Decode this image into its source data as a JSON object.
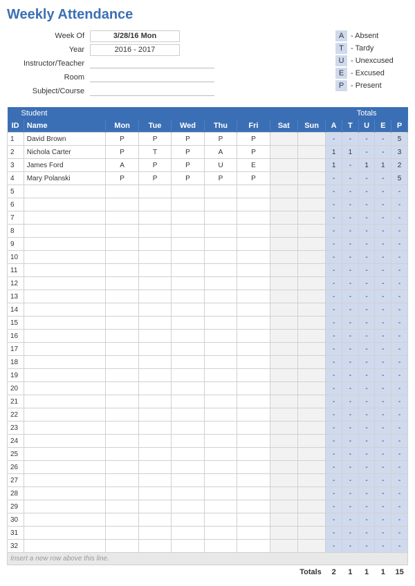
{
  "title": "Weekly Attendance",
  "info": {
    "weekOfLabel": "Week Of",
    "weekOfValue": "3/28/16 Mon",
    "yearLabel": "Year",
    "yearValue": "2016 - 2017",
    "instructorLabel": "Instructor/Teacher",
    "roomLabel": "Room",
    "subjectLabel": "Subject/Course"
  },
  "legend": [
    {
      "code": "A",
      "text": "- Absent"
    },
    {
      "code": "T",
      "text": "- Tardy"
    },
    {
      "code": "U",
      "text": "- Unexcused"
    },
    {
      "code": "E",
      "text": "- Excused"
    },
    {
      "code": "P",
      "text": "- Present"
    }
  ],
  "headers": {
    "student": "Student",
    "totals": "Totals",
    "id": "ID",
    "name": "Name",
    "days": [
      "Mon",
      "Tue",
      "Wed",
      "Thu",
      "Fri",
      "Sat",
      "Sun"
    ],
    "totCols": [
      "A",
      "T",
      "U",
      "E",
      "P"
    ]
  },
  "rows": [
    {
      "id": "1",
      "name": "David Brown",
      "d": [
        "P",
        "P",
        "P",
        "P",
        "P",
        "",
        ""
      ],
      "t": [
        "-",
        "-",
        "-",
        "-",
        "5"
      ]
    },
    {
      "id": "2",
      "name": "Nichola Carter",
      "d": [
        "P",
        "T",
        "P",
        "A",
        "P",
        "",
        ""
      ],
      "t": [
        "1",
        "1",
        "-",
        "-",
        "3"
      ]
    },
    {
      "id": "3",
      "name": "James Ford",
      "d": [
        "A",
        "P",
        "P",
        "U",
        "E",
        "",
        ""
      ],
      "t": [
        "1",
        "-",
        "1",
        "1",
        "2"
      ]
    },
    {
      "id": "4",
      "name": "Mary Polanski",
      "d": [
        "P",
        "P",
        "P",
        "P",
        "P",
        "",
        ""
      ],
      "t": [
        "-",
        "-",
        "-",
        "-",
        "5"
      ]
    },
    {
      "id": "5",
      "name": "",
      "d": [
        "",
        "",
        "",
        "",
        "",
        "",
        ""
      ],
      "t": [
        "-",
        "-",
        "-",
        "-",
        "-"
      ]
    },
    {
      "id": "6",
      "name": "",
      "d": [
        "",
        "",
        "",
        "",
        "",
        "",
        ""
      ],
      "t": [
        "-",
        "-",
        "-",
        "-",
        "-"
      ]
    },
    {
      "id": "7",
      "name": "",
      "d": [
        "",
        "",
        "",
        "",
        "",
        "",
        ""
      ],
      "t": [
        "-",
        "-",
        "-",
        "-",
        "-"
      ]
    },
    {
      "id": "8",
      "name": "",
      "d": [
        "",
        "",
        "",
        "",
        "",
        "",
        ""
      ],
      "t": [
        "-",
        "-",
        "-",
        "-",
        "-"
      ]
    },
    {
      "id": "9",
      "name": "",
      "d": [
        "",
        "",
        "",
        "",
        "",
        "",
        ""
      ],
      "t": [
        "-",
        "-",
        "-",
        "-",
        "-"
      ]
    },
    {
      "id": "10",
      "name": "",
      "d": [
        "",
        "",
        "",
        "",
        "",
        "",
        ""
      ],
      "t": [
        "-",
        "-",
        "-",
        "-",
        "-"
      ]
    },
    {
      "id": "11",
      "name": "",
      "d": [
        "",
        "",
        "",
        "",
        "",
        "",
        ""
      ],
      "t": [
        "-",
        "-",
        "-",
        "-",
        "-"
      ]
    },
    {
      "id": "12",
      "name": "",
      "d": [
        "",
        "",
        "",
        "",
        "",
        "",
        ""
      ],
      "t": [
        "-",
        "-",
        "-",
        "-",
        "-"
      ]
    },
    {
      "id": "13",
      "name": "",
      "d": [
        "",
        "",
        "",
        "",
        "",
        "",
        ""
      ],
      "t": [
        "-",
        "-",
        "-",
        "-",
        "-"
      ]
    },
    {
      "id": "14",
      "name": "",
      "d": [
        "",
        "",
        "",
        "",
        "",
        "",
        ""
      ],
      "t": [
        "-",
        "-",
        "-",
        "-",
        "-"
      ]
    },
    {
      "id": "15",
      "name": "",
      "d": [
        "",
        "",
        "",
        "",
        "",
        "",
        ""
      ],
      "t": [
        "-",
        "-",
        "-",
        "-",
        "-"
      ]
    },
    {
      "id": "16",
      "name": "",
      "d": [
        "",
        "",
        "",
        "",
        "",
        "",
        ""
      ],
      "t": [
        "-",
        "-",
        "-",
        "-",
        "-"
      ]
    },
    {
      "id": "17",
      "name": "",
      "d": [
        "",
        "",
        "",
        "",
        "",
        "",
        ""
      ],
      "t": [
        "-",
        "-",
        "-",
        "-",
        "-"
      ]
    },
    {
      "id": "18",
      "name": "",
      "d": [
        "",
        "",
        "",
        "",
        "",
        "",
        ""
      ],
      "t": [
        "-",
        "-",
        "-",
        "-",
        "-"
      ]
    },
    {
      "id": "19",
      "name": "",
      "d": [
        "",
        "",
        "",
        "",
        "",
        "",
        ""
      ],
      "t": [
        "-",
        "-",
        "-",
        "-",
        "-"
      ]
    },
    {
      "id": "20",
      "name": "",
      "d": [
        "",
        "",
        "",
        "",
        "",
        "",
        ""
      ],
      "t": [
        "-",
        "-",
        "-",
        "-",
        "-"
      ]
    },
    {
      "id": "21",
      "name": "",
      "d": [
        "",
        "",
        "",
        "",
        "",
        "",
        ""
      ],
      "t": [
        "-",
        "-",
        "-",
        "-",
        "-"
      ]
    },
    {
      "id": "22",
      "name": "",
      "d": [
        "",
        "",
        "",
        "",
        "",
        "",
        ""
      ],
      "t": [
        "-",
        "-",
        "-",
        "-",
        "-"
      ]
    },
    {
      "id": "23",
      "name": "",
      "d": [
        "",
        "",
        "",
        "",
        "",
        "",
        ""
      ],
      "t": [
        "-",
        "-",
        "-",
        "-",
        "-"
      ]
    },
    {
      "id": "24",
      "name": "",
      "d": [
        "",
        "",
        "",
        "",
        "",
        "",
        ""
      ],
      "t": [
        "-",
        "-",
        "-",
        "-",
        "-"
      ]
    },
    {
      "id": "25",
      "name": "",
      "d": [
        "",
        "",
        "",
        "",
        "",
        "",
        ""
      ],
      "t": [
        "-",
        "-",
        "-",
        "-",
        "-"
      ]
    },
    {
      "id": "26",
      "name": "",
      "d": [
        "",
        "",
        "",
        "",
        "",
        "",
        ""
      ],
      "t": [
        "-",
        "-",
        "-",
        "-",
        "-"
      ]
    },
    {
      "id": "27",
      "name": "",
      "d": [
        "",
        "",
        "",
        "",
        "",
        "",
        ""
      ],
      "t": [
        "-",
        "-",
        "-",
        "-",
        "-"
      ]
    },
    {
      "id": "28",
      "name": "",
      "d": [
        "",
        "",
        "",
        "",
        "",
        "",
        ""
      ],
      "t": [
        "-",
        "-",
        "-",
        "-",
        "-"
      ]
    },
    {
      "id": "29",
      "name": "",
      "d": [
        "",
        "",
        "",
        "",
        "",
        "",
        ""
      ],
      "t": [
        "-",
        "-",
        "-",
        "-",
        "-"
      ]
    },
    {
      "id": "30",
      "name": "",
      "d": [
        "",
        "",
        "",
        "",
        "",
        "",
        ""
      ],
      "t": [
        "-",
        "-",
        "-",
        "-",
        "-"
      ]
    },
    {
      "id": "31",
      "name": "",
      "d": [
        "",
        "",
        "",
        "",
        "",
        "",
        ""
      ],
      "t": [
        "-",
        "-",
        "-",
        "-",
        "-"
      ]
    },
    {
      "id": "32",
      "name": "",
      "d": [
        "",
        "",
        "",
        "",
        "",
        "",
        ""
      ],
      "t": [
        "-",
        "-",
        "-",
        "-",
        "-"
      ]
    }
  ],
  "insertRowText": "Insert a new row above this line.",
  "grandTotals": {
    "label": "Totals",
    "vals": [
      "2",
      "1",
      "1",
      "1",
      "15"
    ]
  }
}
